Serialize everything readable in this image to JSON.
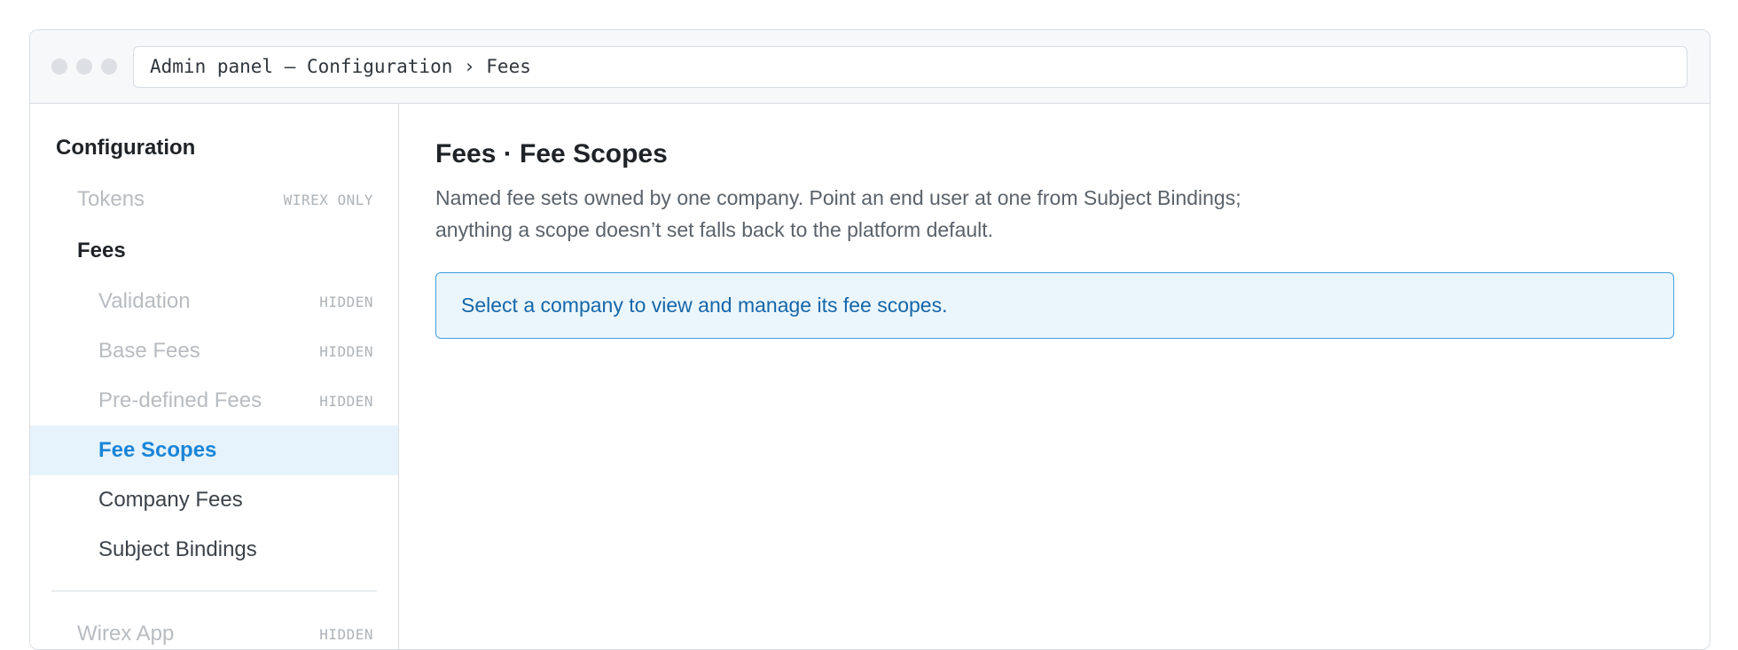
{
  "titlebar": {
    "address": "Admin panel — Configuration › Fees"
  },
  "sidebar": {
    "heading": "Configuration",
    "items": [
      {
        "label": "Tokens",
        "badge": "WIREX ONLY"
      },
      {
        "label": "Fees",
        "badge": ""
      },
      {
        "label": "Validation",
        "badge": "HIDDEN"
      },
      {
        "label": "Base Fees",
        "badge": "HIDDEN"
      },
      {
        "label": "Pre-defined Fees",
        "badge": "HIDDEN"
      },
      {
        "label": "Fee Scopes",
        "badge": ""
      },
      {
        "label": "Company Fees",
        "badge": ""
      },
      {
        "label": "Subject Bindings",
        "badge": ""
      },
      {
        "label": "Wirex App",
        "badge": "HIDDEN"
      }
    ]
  },
  "main": {
    "title": "Fees · Fee Scopes",
    "description": "Named fee sets owned by one company. Point an end user at one from Subject Bindings; anything a scope doesn’t set falls back to the platform default.",
    "notice": "Select a company to view and manage its fee scopes."
  }
}
